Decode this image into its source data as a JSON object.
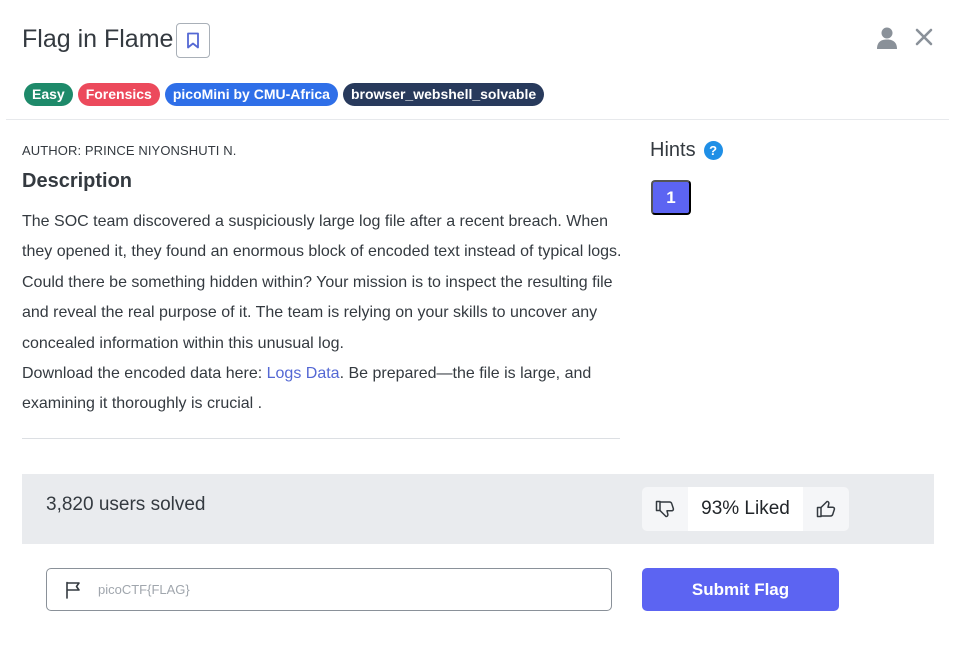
{
  "challenge": {
    "title": "Flag in Flame",
    "tags": [
      {
        "label": "Easy",
        "color": "#1e8a6a"
      },
      {
        "label": "Forensics",
        "color": "#ec4a5c"
      },
      {
        "label": "picoMini by CMU-Africa",
        "color": "#2f6fe8"
      },
      {
        "label": "browser_webshell_solvable",
        "color": "#283a5c"
      }
    ],
    "author": "AUTHOR: PRINCE NIYONSHUTI N.",
    "description_heading": "Description",
    "description_text": "The SOC team discovered a suspiciously large log file after a recent breach. When they opened it, they found an enormous block of encoded text instead of typical logs. Could there be something hidden within? Your mission is to inspect the resulting file and reveal the real purpose of it. The team is relying on your skills to uncover any concealed information within this unusual log.",
    "download_prefix": "Download the encoded data here: ",
    "download_link": "Logs Data",
    "download_suffix": ". Be prepared—the file is large, and examining it thoroughly is crucial ."
  },
  "hints": {
    "title": "Hints",
    "help_glyph": "?",
    "items": [
      "1"
    ]
  },
  "stats": {
    "solved": "3,820 users solved",
    "liked": "93% Liked"
  },
  "submit": {
    "placeholder": "picoCTF{FLAG}",
    "button_label": "Submit Flag"
  },
  "icons": {
    "bookmark": "bookmark-icon",
    "user": "user-icon",
    "close": "close-icon",
    "help": "help-icon",
    "thumbs_down": "thumbs-down-icon",
    "thumbs_up": "thumbs-up-icon",
    "flag": "flag-icon"
  },
  "colors": {
    "accent": "#5c64f2",
    "link": "#5468d4",
    "stats_bg": "#e9ebee"
  }
}
